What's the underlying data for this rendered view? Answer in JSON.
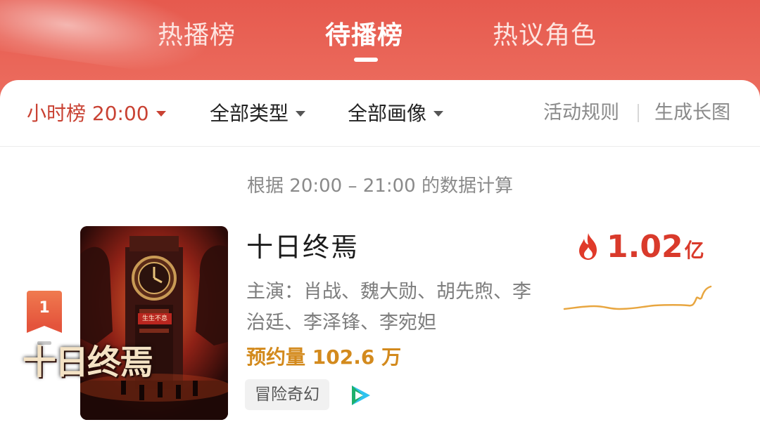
{
  "tabs": [
    {
      "label": "热播榜",
      "active": false
    },
    {
      "label": "待播榜",
      "active": true
    },
    {
      "label": "热议角色",
      "active": false
    }
  ],
  "filters": {
    "hour_label": "小时榜 20:00",
    "type_label": "全部类型",
    "persona_label": "全部画像"
  },
  "links": {
    "rules": "活动规则",
    "long_image": "生成长图"
  },
  "basis_text": "根据 20:00 – 21:00 的数据计算",
  "item": {
    "rank": "1",
    "title": "十日终焉",
    "cast": "主演：肖战、魏大勋、胡先煦、李治廷、李泽锋、李宛妲",
    "reservations": "预约量 102.6 万",
    "genre": "冒险奇幻",
    "heat_value": "1.02",
    "heat_unit": "亿",
    "poster_title": "十日终焉",
    "poster_tagline": "生生不息",
    "platform_icon": "tencent-video-icon"
  },
  "colors": {
    "header": "#e65a4e",
    "accent_red": "#d93a2b",
    "reservation_orange": "#d38a1d",
    "sparkline": "#e8a640"
  }
}
